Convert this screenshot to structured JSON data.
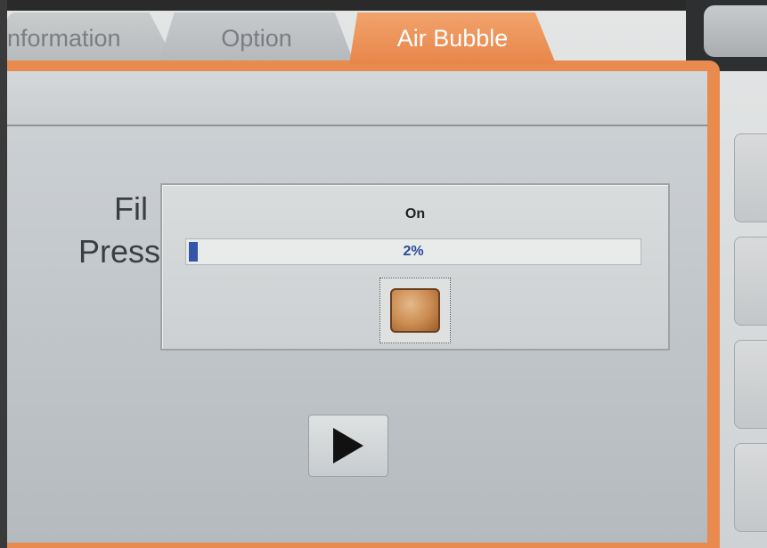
{
  "tabs": [
    {
      "label": "nformation"
    },
    {
      "label": "Option"
    },
    {
      "label": "Air Bubble"
    }
  ],
  "background_labels": {
    "fill": "Fil",
    "pressure": "Press"
  },
  "dialog": {
    "status": "On",
    "progress": {
      "percent": 2,
      "label": "2%"
    }
  },
  "colors": {
    "accent_orange": "#e98a4f",
    "progress_blue": "#3355aa"
  },
  "icons": {
    "stop": "stop-icon",
    "play": "play-icon"
  }
}
